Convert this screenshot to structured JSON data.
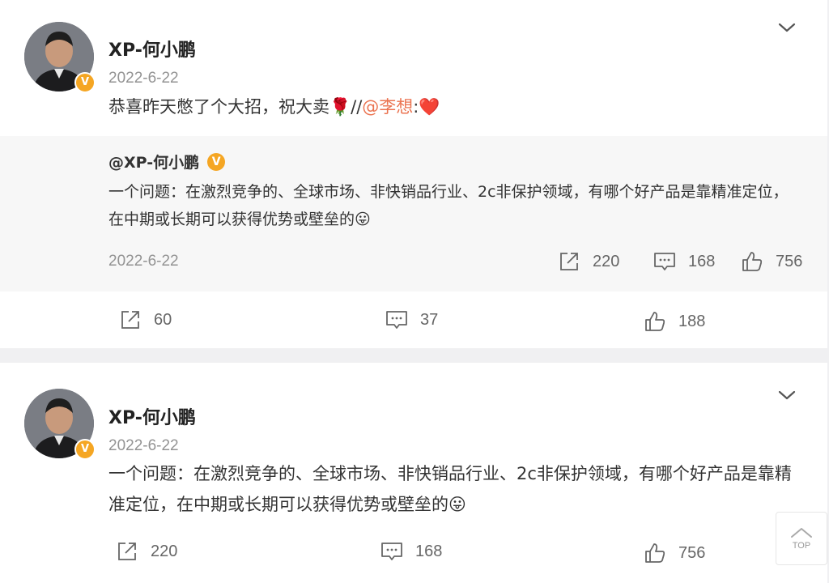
{
  "posts": [
    {
      "username": "XP-何小鹏",
      "date": "2022-6-22",
      "text_main": "恭喜昨天憋了个大招，祝大卖🌹//",
      "mention": "@李想",
      "text_tail": ":❤️",
      "repost": {
        "user": "@XP-何小鹏",
        "text": "一个问题：在激烈竞争的、全球市场、非快销品行业、2c非保护领域，有哪个好产品是靠精准定位，在中期或长期可以获得优势或壁垒的😛",
        "date": "2022-6-22",
        "repost_count": "220",
        "comment_count": "168",
        "like_count": "756"
      },
      "repost_count": "60",
      "comment_count": "37",
      "like_count": "188"
    },
    {
      "username": "XP-何小鹏",
      "date": "2022-6-22",
      "text": "一个问题：在激烈竞争的、全球市场、非快销品行业、2c非保护领域，有哪个好产品是靠精准定位，在中期或长期可以获得优势或壁垒的😛",
      "repost_count": "220",
      "comment_count": "168",
      "like_count": "756"
    }
  ],
  "verified_badge": "V",
  "top_button_label": "TOP",
  "icons": {
    "share": "share-icon",
    "comment": "comment-icon",
    "like": "like-icon",
    "menu": "chevron-down-icon"
  },
  "colors": {
    "mention": "#eb7350",
    "badge": "#f5a623"
  }
}
